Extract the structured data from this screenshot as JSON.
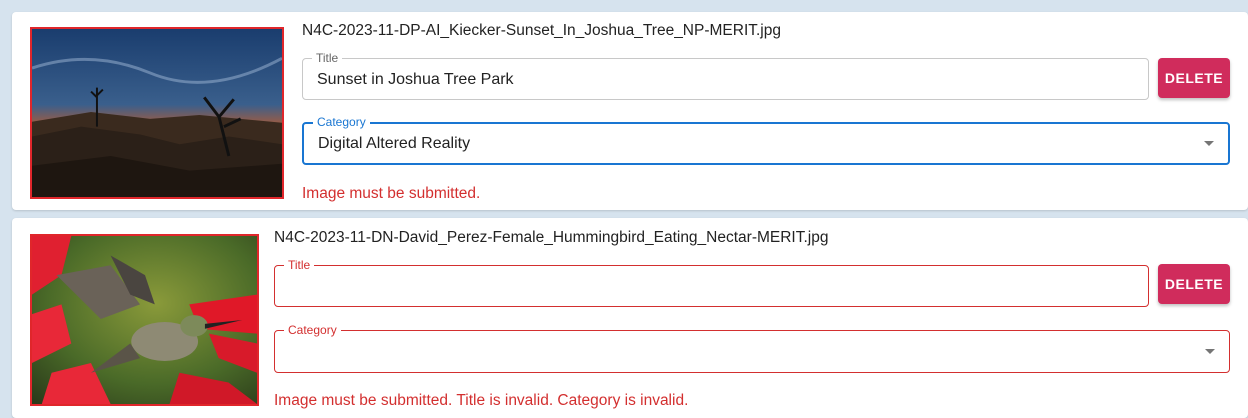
{
  "entries": [
    {
      "filename": "N4C-2023-11-DP-AI_Kiecker-Sunset_In_Joshua_Tree_NP-MERIT.jpg",
      "title_label": "Title",
      "title_value": "Sunset in Joshua Tree Park",
      "delete_label": "DELETE",
      "category_label": "Category",
      "category_value": "Digital Altered Reality",
      "error": "Image must be submitted."
    },
    {
      "filename": "N4C-2023-11-DN-David_Perez-Female_Hummingbird_Eating_Nectar-MERIT.jpg",
      "title_label": "Title",
      "title_value": "",
      "delete_label": "DELETE",
      "category_label": "Category",
      "category_value": "",
      "error": "Image must be submitted. Title is invalid. Category is invalid."
    }
  ],
  "colors": {
    "accent": "#1976d2",
    "error": "#d32f2f",
    "delete_button": "#d02c5c",
    "page_background": "#d6e3ee"
  }
}
